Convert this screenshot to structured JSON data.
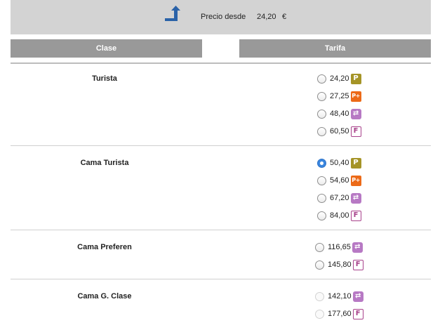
{
  "header": {
    "price_label": "Precio desde",
    "price_value": "24,20",
    "currency": "€"
  },
  "table": {
    "col_clase": "Clase",
    "col_tarifa": "Tarifa"
  },
  "rows": [
    {
      "name": "Turista",
      "options": [
        {
          "price": "24,20",
          "badge": "P",
          "badge_type": "P",
          "state": "unchecked"
        },
        {
          "price": "27,25",
          "badge": "P+",
          "badge_type": "Pp",
          "state": "unchecked"
        },
        {
          "price": "48,40",
          "badge": "⇄",
          "badge_type": "X",
          "state": "unchecked"
        },
        {
          "price": "60,50",
          "badge": "F",
          "badge_type": "F",
          "state": "unchecked"
        }
      ]
    },
    {
      "name": "Cama Turista",
      "options": [
        {
          "price": "50,40",
          "badge": "P",
          "badge_type": "P",
          "state": "checked"
        },
        {
          "price": "54,60",
          "badge": "P+",
          "badge_type": "Pp",
          "state": "unchecked"
        },
        {
          "price": "67,20",
          "badge": "⇄",
          "badge_type": "X",
          "state": "unchecked"
        },
        {
          "price": "84,00",
          "badge": "F",
          "badge_type": "F",
          "state": "unchecked"
        }
      ]
    },
    {
      "name": "Cama Preferen",
      "options": [
        {
          "price": "116,65",
          "badge": "⇄",
          "badge_type": "X",
          "state": "unchecked"
        },
        {
          "price": "145,80",
          "badge": "F",
          "badge_type": "F",
          "state": "unchecked"
        }
      ]
    },
    {
      "name": "Cama G. Clase",
      "options": [
        {
          "price": "142,10",
          "badge": "⇄",
          "badge_type": "X",
          "state": "disabled"
        },
        {
          "price": "177,60",
          "badge": "F",
          "badge_type": "F",
          "state": "disabled"
        }
      ]
    }
  ],
  "colors": {
    "header_bg": "#d3d3d3",
    "column_header_bg": "#999999",
    "arrow_blue": "#2a62a8",
    "badge_p": "#a59427",
    "badge_p_plus": "#ec6a18",
    "badge_exchange": "#b779c4",
    "badge_f": "#a8428b",
    "radio_checked": "#3a86de"
  }
}
